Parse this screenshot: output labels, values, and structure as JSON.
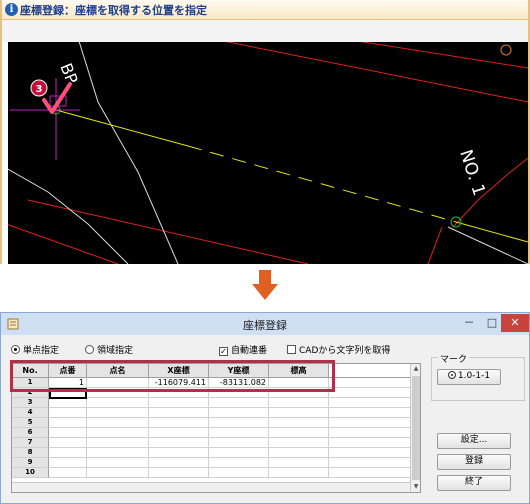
{
  "cad": {
    "header_title": "座標登録：座標を取得する位置を指定",
    "step_badge": "3",
    "label_bp": "BP",
    "label_no1": "NO. 1",
    "colors": {
      "background": "#000000",
      "centerline": "#e6e600",
      "boundary": "#e02020",
      "road_edge": "#dcdcdc",
      "crosshair": "#c020c0",
      "marker": "#20c020"
    }
  },
  "dialog": {
    "title": "座標登録",
    "window_buttons": {
      "minimize": "－",
      "maximize": "□",
      "close": "✕"
    },
    "options": {
      "single_point": "単点指定",
      "area": "領域指定",
      "auto_number": "自動連番",
      "cad_text": "CADから文字列を取得"
    },
    "grid": {
      "columns": [
        "No.",
        "点番",
        "点名",
        "X座標",
        "Y座標",
        "標高"
      ],
      "rows": [
        {
          "no": "1",
          "point_no": "1",
          "name": "",
          "x": "-116079.411",
          "y": "-83131.082",
          "elev": ""
        },
        {
          "no": "2"
        },
        {
          "no": "3"
        },
        {
          "no": "4"
        },
        {
          "no": "5"
        },
        {
          "no": "6"
        },
        {
          "no": "7"
        },
        {
          "no": "8"
        },
        {
          "no": "9"
        },
        {
          "no": "10"
        }
      ]
    },
    "mark": {
      "legend": "マーク",
      "button": "1.0-1-1"
    },
    "buttons": {
      "settings": "設定...",
      "register": "登録",
      "end": "終了"
    },
    "accent_color": "#b0304a"
  }
}
